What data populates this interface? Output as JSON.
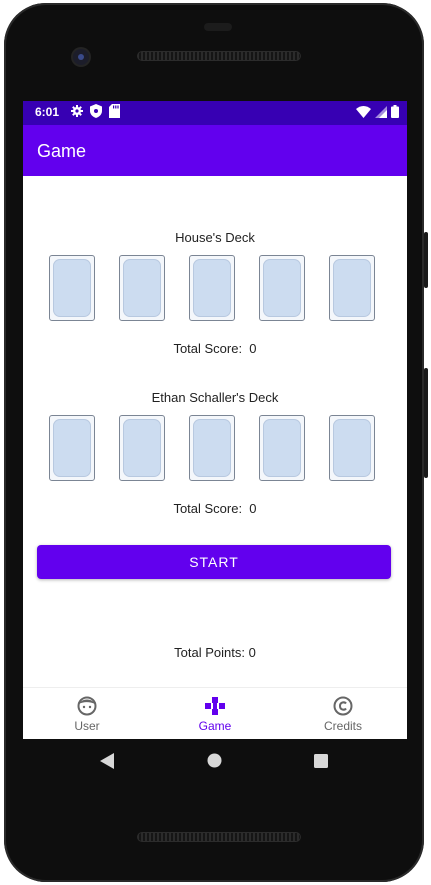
{
  "status": {
    "time": "6:01"
  },
  "appbar": {
    "title": "Game"
  },
  "house": {
    "title": "House's Deck",
    "score": "Total Score:  0"
  },
  "player": {
    "title": "Ethan Schaller's Deck",
    "score": "Total Score:  0"
  },
  "start_label": "START",
  "total_points": "Total Points: 0",
  "nav": {
    "items": [
      {
        "label": "User",
        "icon": "face-icon",
        "active": false
      },
      {
        "label": "Game",
        "icon": "gamepad-icon",
        "active": true
      },
      {
        "label": "Credits",
        "icon": "copyright-icon",
        "active": false
      }
    ]
  },
  "colors": {
    "primary": "#6200ee",
    "primary_dark": "#3700b3",
    "card_back": "#ccdcf0"
  }
}
